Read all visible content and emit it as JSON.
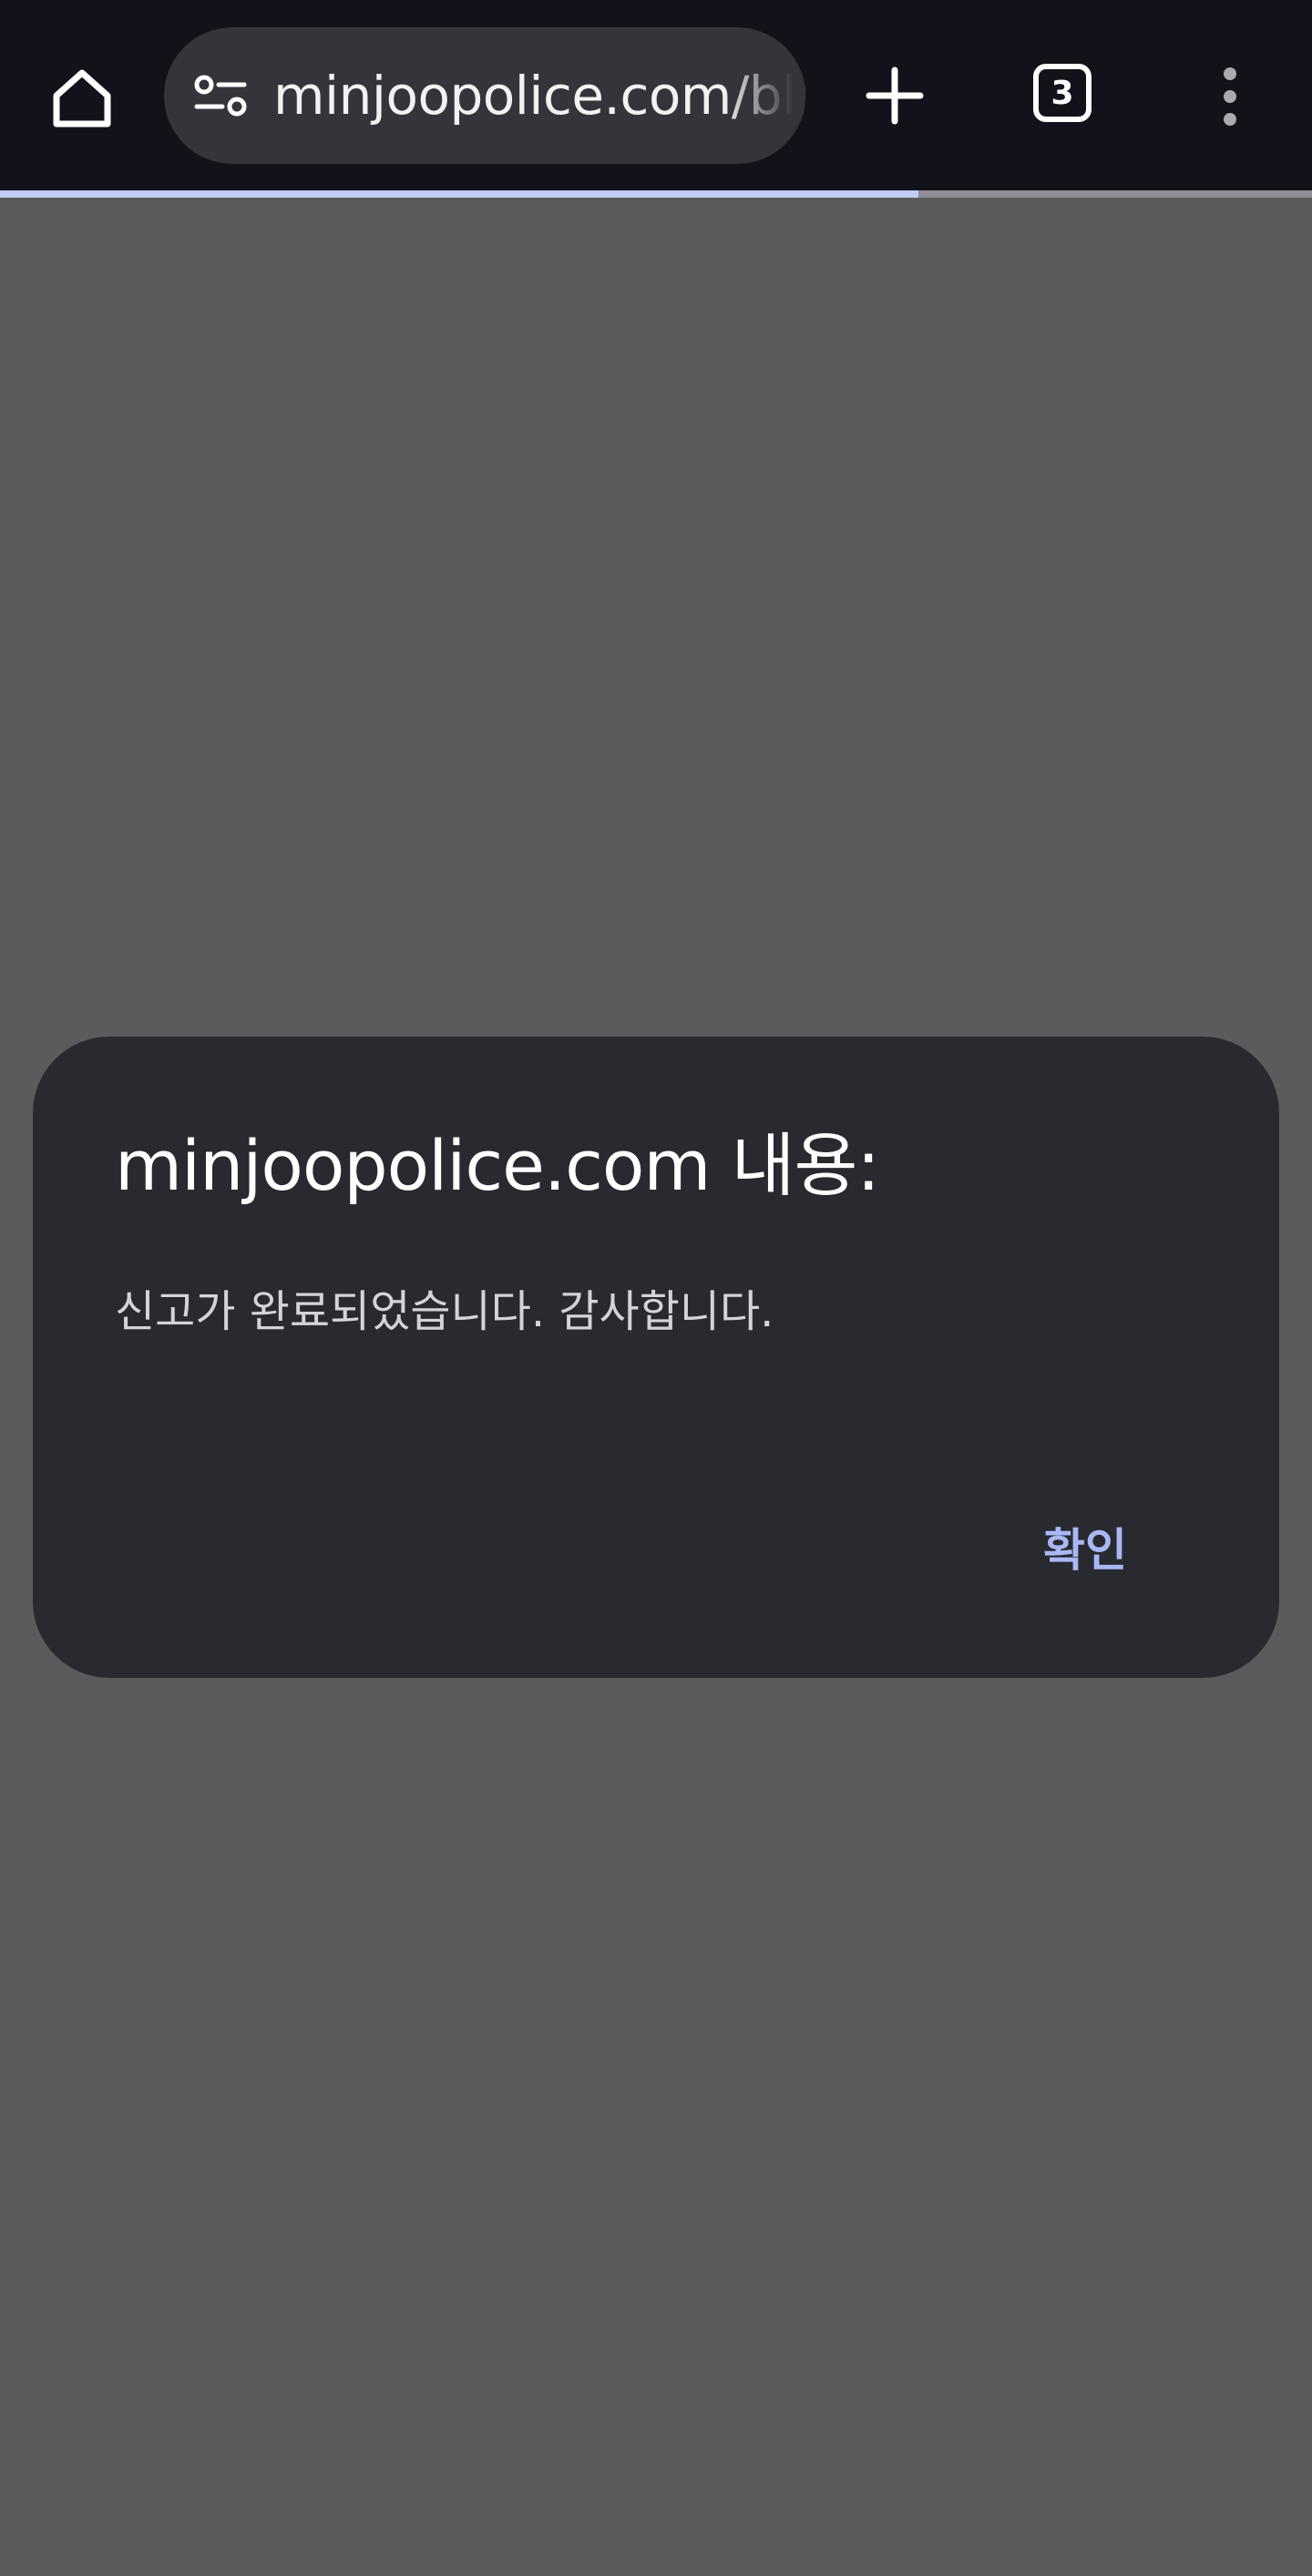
{
  "browser": {
    "url_text": "minjoopolice.com/bb",
    "tab_count": "3",
    "icons": {
      "home": "home-icon",
      "site_info": "tune-icon",
      "new_tab": "plus-icon",
      "menu": "more-vert-icon"
    },
    "load_progress": 0.7
  },
  "dialog": {
    "title": "minjoopolice.com 내용:",
    "message": "신고가 완료되었습니다. 감사합니다.",
    "ok_label": "확인"
  },
  "colors": {
    "toolbar_bg": "#12131a",
    "scrim_bg": "#5b5b5b",
    "dialog_bg": "#292a30",
    "accent": "#a9b8f5"
  }
}
